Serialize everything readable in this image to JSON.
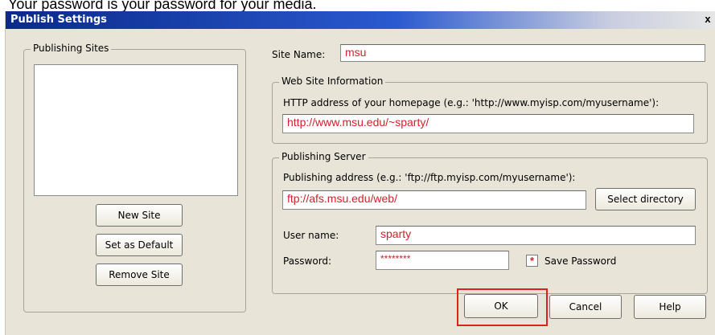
{
  "header_text": "Your password is your password for your media.",
  "dialog": {
    "title": "Publish Settings",
    "close_label": "x"
  },
  "publishing_sites": {
    "legend": "Publishing Sites",
    "new_site": "New Site",
    "set_default": "Set as Default",
    "remove_site": "Remove Site"
  },
  "site_name": {
    "label": "Site Name:",
    "value": "msu"
  },
  "web_info": {
    "legend": "Web Site Information",
    "http_label": "HTTP address of your homepage (e.g.: 'http://www.myisp.com/myusername'):",
    "http_value": "http://www.msu.edu/~sparty/"
  },
  "server": {
    "legend": "Publishing Server",
    "address_label": "Publishing address (e.g.: 'ftp://ftp.myisp.com/myusername'):",
    "address_value": "ftp://afs.msu.edu/web/",
    "select_directory": "Select directory",
    "user_label": "User name:",
    "user_value": "sparty",
    "password_label": "Password:",
    "password_value": "********",
    "save_password_label": "Save Password",
    "save_password_checked": "*"
  },
  "buttons": {
    "ok": "OK",
    "cancel": "Cancel",
    "help": "Help"
  },
  "colors": {
    "input_text": "#d4202a",
    "highlight": "#e0201a"
  }
}
